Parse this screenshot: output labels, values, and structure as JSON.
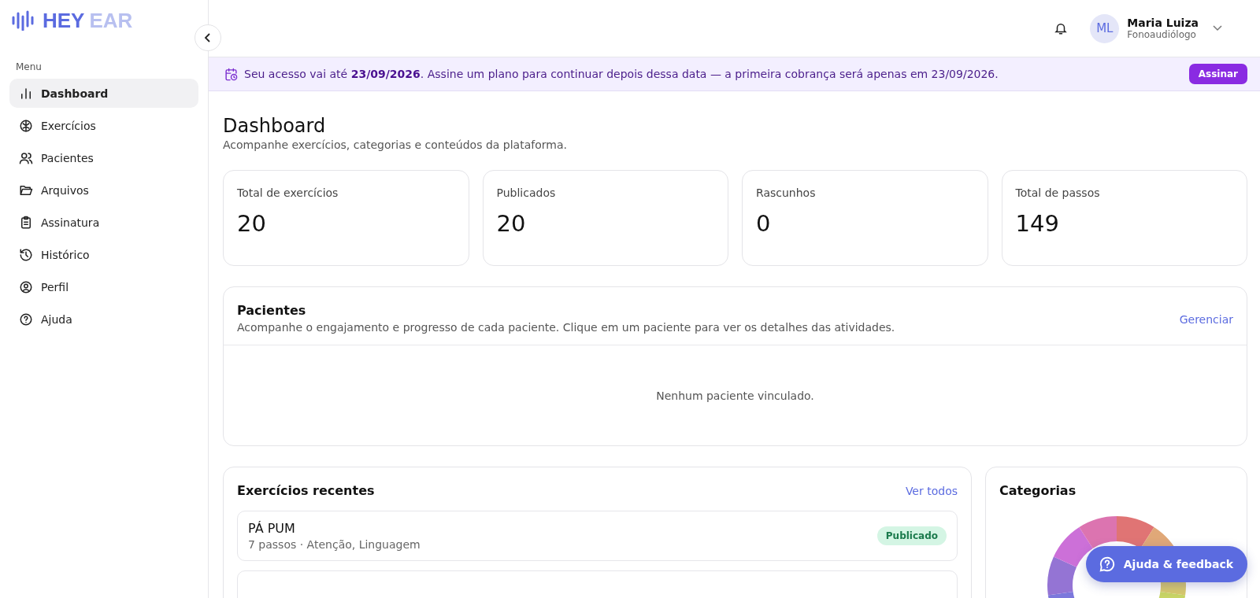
{
  "brand": {
    "part_1": "HEY",
    "part_2": "EAR"
  },
  "sidebar": {
    "heading": "Menu",
    "items": [
      {
        "label": "Dashboard",
        "selected": true
      },
      {
        "label": "Exercícios",
        "selected": false
      },
      {
        "label": "Pacientes",
        "selected": false
      },
      {
        "label": "Arquivos",
        "selected": false
      },
      {
        "label": "Assinatura",
        "selected": false
      },
      {
        "label": "Histórico",
        "selected": false
      },
      {
        "label": "Perfil",
        "selected": false
      },
      {
        "label": "Ajuda",
        "selected": false
      }
    ]
  },
  "user": {
    "initials": "ML",
    "name": "Maria Luiza",
    "role": "Fonoaudiólogo"
  },
  "banner": {
    "text": "Seu acesso vai até **23/09/2026**. Assine um plano para continuar depois dessa data — a primeira cobrança será apenas em 23/09/2026.",
    "button": "Assinar"
  },
  "page": {
    "title": "Dashboard",
    "subtitle": "Acompanhe exercícios, categorias e conteúdos da plataforma."
  },
  "stats": [
    {
      "label": "Total de exercícios",
      "value": "20"
    },
    {
      "label": "Publicados",
      "value": "20"
    },
    {
      "label": "Rascunhos",
      "value": "0"
    },
    {
      "label": "Total de passos",
      "value": "149"
    }
  ],
  "patients": {
    "title": "Pacientes",
    "subtitle": "Acompanhe o engajamento e progresso de cada paciente. Clique em um paciente para ver os detalhes das atividades.",
    "link": "Gerenciar",
    "empty": "Nenhum paciente vinculado."
  },
  "recent": {
    "title": "Exercícios recentes",
    "link": "Ver todos",
    "items": [
      {
        "name": "PÁ PUM",
        "meta": "7 passos · Atenção, Linguagem",
        "published": true,
        "badge": "Publicado"
      }
    ]
  },
  "categories": {
    "title": "Categorias"
  },
  "help_button": "Ajuda & feedback"
}
